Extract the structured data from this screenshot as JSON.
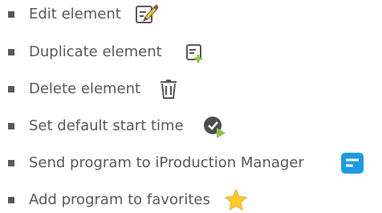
{
  "actions": [
    {
      "label": "Edit element",
      "icon": "edit-icon"
    },
    {
      "label": "Duplicate element",
      "icon": "duplicate-icon"
    },
    {
      "label": "Delete element",
      "icon": "trash-icon"
    },
    {
      "label": "Set default start time",
      "icon": "check-play-icon"
    },
    {
      "label": "Send program to iProduction Manager",
      "icon": "iproduction-manager-icon"
    },
    {
      "label": "Add program to favorites",
      "icon": "star-icon"
    }
  ],
  "colors": {
    "text": "#58595b",
    "bullet": "#58595b",
    "green_accent": "#8bc34a",
    "blue_accent": "#1e9be0",
    "star": "#ffc928",
    "dark": "#4d4d4f"
  }
}
